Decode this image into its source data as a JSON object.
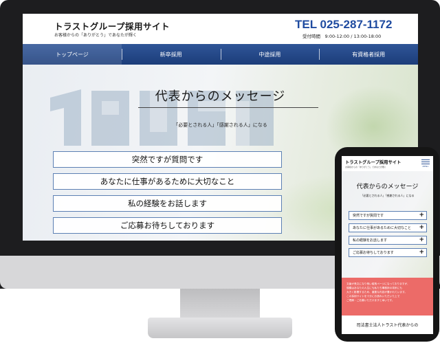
{
  "desktop": {
    "header": {
      "site_title": "トラストグループ採用サイト",
      "tagline": "お客様からの「ありがとう」であなたが輝く",
      "tel": "TEL 025-287-1172",
      "hours": "受付時間　9:00-12:00 / 13:00-18:00"
    },
    "nav": {
      "items": [
        {
          "label": "トップページ"
        },
        {
          "label": "新卒採用"
        },
        {
          "label": "中途採用"
        },
        {
          "label": "有資格者採用"
        }
      ]
    },
    "hero": {
      "title": "代表からのメッセージ",
      "subtitle": "「必要とされる人」「感謝される人」になる"
    },
    "messages": [
      {
        "label": "突然ですが質問です"
      },
      {
        "label": "あなたに仕事があるために大切なこと"
      },
      {
        "label": "私の経験をお話します"
      },
      {
        "label": "ご応募お待ちしております"
      }
    ]
  },
  "mobile": {
    "site_title": "トラストグループ採用サイト",
    "tagline": "お客様からの「ありがとう」であなたが輝く",
    "menu_label": "MENU",
    "hero": {
      "title": "代表からのメッセージ",
      "subtitle": "「必要とされる人」「感謝される人」になる"
    },
    "messages": [
      {
        "label": "突然ですが質問です"
      },
      {
        "label": "あなたに仕事があるために大切なこと"
      },
      {
        "label": "私の経験をお話します"
      },
      {
        "label": "ご応募お待ちしております"
      }
    ],
    "plus_symbol": "+",
    "notice_lines": [
      "文章が長文になり長い縦長ページになっておりますが、",
      "規模はあなたの人生にも私たち事務所の将来にも",
      "大きく影響するため、重要な内容が書かれています。",
      "この採用サイトを十分にお読みいただいた上で",
      "ご理解・ご応募いただけますと幸いです。"
    ],
    "footer_title": "司法書士法人トラスト代表からの"
  },
  "colors": {
    "brand_blue": "#1f4ba0",
    "nav_blue": "#2f5597",
    "notice_red": "#ec6b68"
  }
}
